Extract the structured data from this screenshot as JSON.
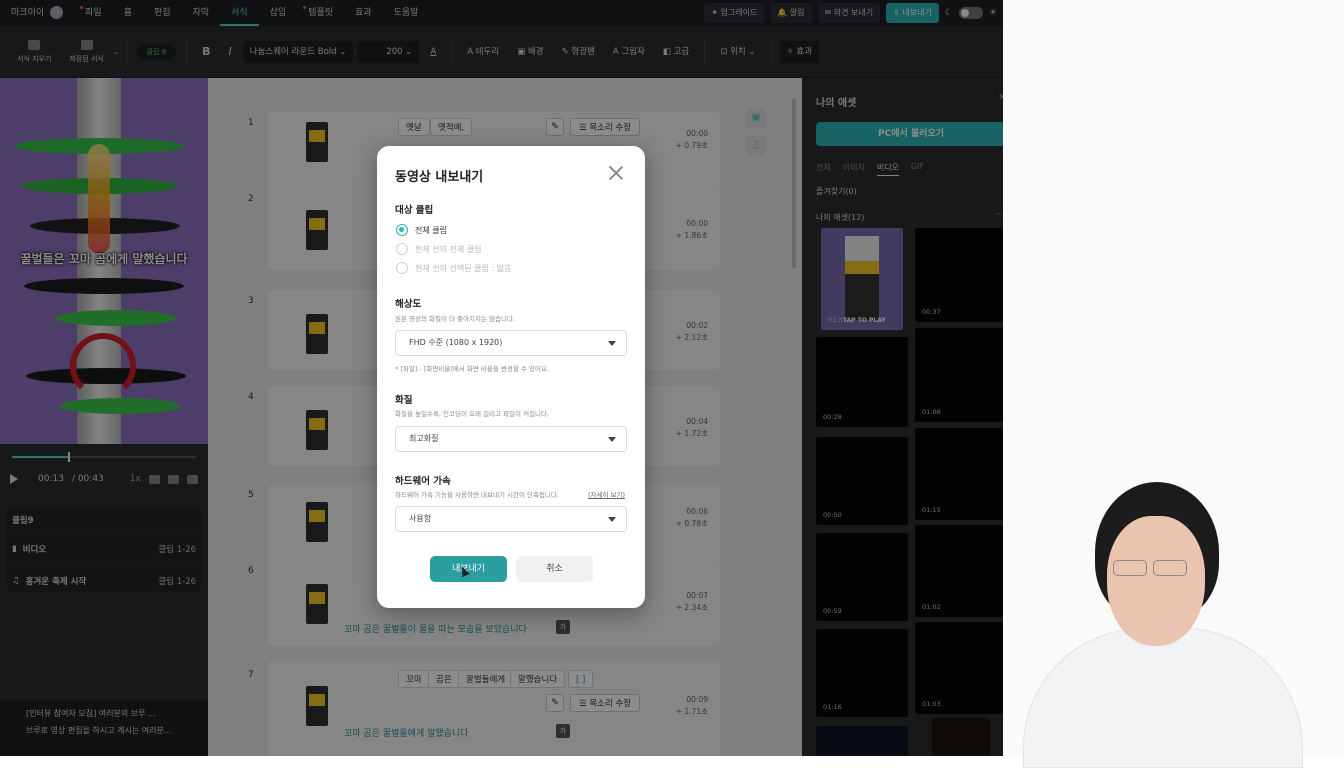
{
  "menubar": {
    "user": "마크이이",
    "items": [
      "파일",
      "홈",
      "편집",
      "자막",
      "서식",
      "삽입",
      "템플릿",
      "효과",
      "도움말"
    ],
    "active_index": 4,
    "upgrade": "업그레이드",
    "alarm": "알림",
    "feedback": "의견 보내기",
    "export": "내보내기"
  },
  "toolbar": {
    "clear_format": "서식 지우기",
    "saved_format": "저장된 서식",
    "clip_chip": "클립 9",
    "bold": "B",
    "italic": "I",
    "font": "나눔스퀘어 라운드 Bold",
    "font_size": "200",
    "border": "테두리",
    "background": "배경",
    "highlighter": "형광펜",
    "shadow": "그림자",
    "advanced": "고급",
    "position": "위치",
    "effect": "효과"
  },
  "preview": {
    "subtitle": "꿀벌들은 꼬마 곰에게 말했습니다",
    "current_time": "00:13",
    "total_time": "/ 00:43",
    "speed": "1x"
  },
  "clip_panel": {
    "title": "클립9",
    "rows": [
      {
        "label": "비디오",
        "range": "클립 1-26"
      },
      {
        "label": "흥겨운 축제 시작",
        "range": "클립 1-26"
      }
    ]
  },
  "notice": {
    "line1": "[인터뷰 참여자 모집] 여러분의 브루 ...",
    "line2": "브루로 영상 편집을 하시고 계시는 여러분..."
  },
  "scenes": [
    {
      "num": "1",
      "time": "00:00",
      "dur": "+ 0.79초",
      "words": [
        "옛날",
        "옛적에,"
      ]
    },
    {
      "num": "2",
      "time": "00:00",
      "dur": "+ 1.86초",
      "words": []
    },
    {
      "num": "3",
      "time": "00:02",
      "dur": "+ 2.12초",
      "words": []
    },
    {
      "num": "4",
      "time": "00:04",
      "dur": "+ 1.72초",
      "words": []
    },
    {
      "num": "5",
      "time": "00:06",
      "dur": "+ 0.78초",
      "words": []
    },
    {
      "num": "6",
      "time": "00:07",
      "dur": "+ 2.34초",
      "words": [],
      "subtitle": "꼬마 곰은 꿀벌들이 꿀을 따는 모습을 보았습니다"
    },
    {
      "num": "7",
      "time": "00:09",
      "dur": "+ 1.71초",
      "words": [
        "꼬마",
        "곰은",
        "꿀벌들에게",
        "말했습니다",
        "[ ]"
      ],
      "subtitle": "꼬마 곰은 꿀벌들에게 말했습니다"
    }
  ],
  "scene_voice_btn": "목소리 수정",
  "ga": "가",
  "assets": {
    "title": "나의 애셋",
    "upload": "PC에서 불러오기",
    "tabs": [
      "전체",
      "이미지",
      "비디오",
      "GIF"
    ],
    "active_tab": 2,
    "favorites": "즐겨찾기(0)",
    "mine": "나의 애셋(12)",
    "tiles": [
      "01:37",
      "00:37",
      "00:28",
      "01:08",
      "00:50",
      "01:15",
      "00:59",
      "01:02",
      "01:16",
      "01:03"
    ],
    "tap_to_play": "TAP TO PLAY"
  },
  "modal": {
    "title": "동영상 내보내기",
    "target_section": "대상 클립",
    "radio_all": "전체 클립",
    "radio_current": "현재 씬의 전체 클립",
    "radio_selected": "현재 씬의 선택된 클립 : 없음",
    "resolution_section": "해상도",
    "resolution_desc": "원본 영상의 화질이 더 좋아지지는 않습니다.",
    "resolution_value": "FHD 수준 (1080 x 1920)",
    "resolution_note": "* [파일] - [화면비율]에서 화면 비율을 변경할 수 있어요.",
    "quality_section": "화질",
    "quality_desc": "화질을 높일수록, 인코딩이 오래 걸리고 파일이 커집니다.",
    "quality_value": "최고화질",
    "hw_section": "하드웨어 가속",
    "hw_desc": "하드웨어 가속 기능을 사용하면 내보내기 시간이 단축됩니다.",
    "hw_link": "(자세히 보기)",
    "hw_value": "사용함",
    "export_btn": "내보내기",
    "cancel_btn": "취소"
  }
}
